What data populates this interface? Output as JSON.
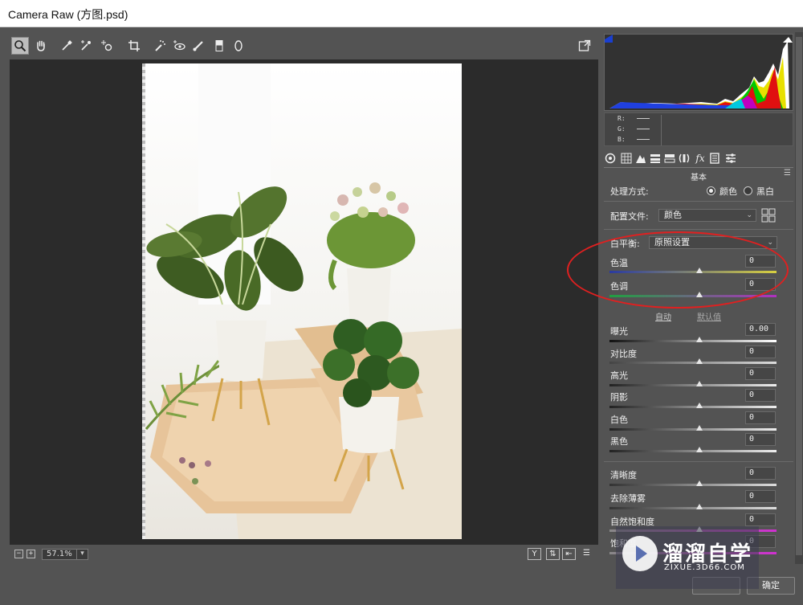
{
  "window": {
    "title": "Camera Raw (方图.psd)"
  },
  "toolbar": {
    "tools": [
      "zoom-icon",
      "hand-icon",
      "white-balance-icon",
      "color-sampler-icon",
      "target-adjust-icon",
      "crop-icon",
      "spot-removal-icon",
      "red-eye-icon",
      "adjustment-brush-icon",
      "graduated-filter-icon",
      "radial-filter-icon"
    ],
    "fullscreen_icon": "fullscreen-icon"
  },
  "histogram": {
    "r_label": "R:",
    "g_label": "G:",
    "b_label": "B:"
  },
  "panel": {
    "title": "基本",
    "treatment_label": "处理方式:",
    "treatment_color": "颜色",
    "treatment_bw": "黑白",
    "profile_label": "配置文件:",
    "profile_value": "颜色",
    "wb_label": "白平衡:",
    "wb_value": "原照设置",
    "temp_label": "色温",
    "temp_value": "0",
    "tint_label": "色调",
    "tint_value": "0",
    "auto_label": "自动",
    "default_label": "默认值",
    "exposure_label": "曝光",
    "exposure_value": "0.00",
    "contrast_label": "对比度",
    "contrast_value": "0",
    "highlights_label": "高光",
    "highlights_value": "0",
    "shadows_label": "阴影",
    "shadows_value": "0",
    "whites_label": "白色",
    "whites_value": "0",
    "blacks_label": "黑色",
    "blacks_value": "0",
    "clarity_label": "清晰度",
    "clarity_value": "0",
    "dehaze_label": "去除薄雾",
    "dehaze_value": "0",
    "vibrance_label": "自然饱和度",
    "vibrance_value": "0",
    "saturation_label": "饱和度",
    "saturation_value": "0"
  },
  "statusbar": {
    "zoom": "57.1%",
    "y_label": "Y"
  },
  "buttons": {
    "ok": "确定"
  },
  "watermark": {
    "brand": "溜溜自学",
    "url": "ZIXUE.3D66.COM"
  },
  "colors": {
    "annotation": "#e02020",
    "panel_bg": "#535353",
    "canvas_bg": "#2b2b2b"
  }
}
